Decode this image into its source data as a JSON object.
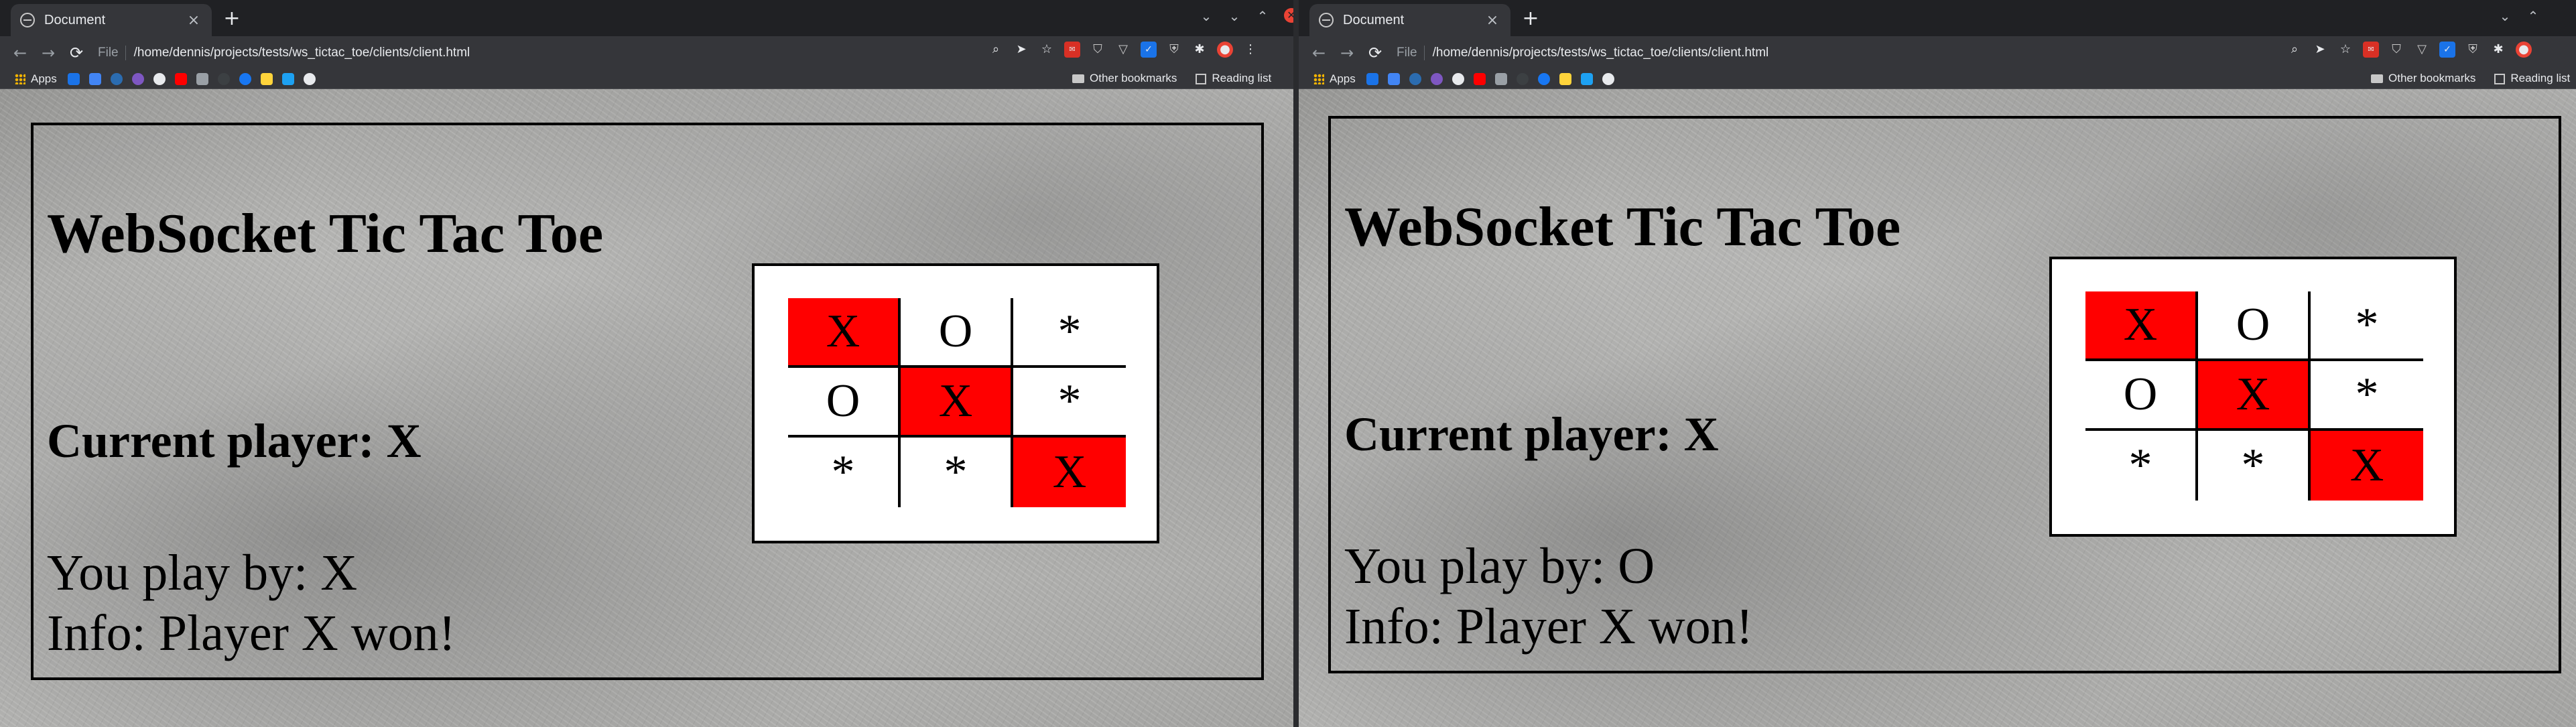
{
  "windows": [
    {
      "tab": {
        "title": "Document",
        "close": "×"
      },
      "new_tab": "+",
      "address": {
        "scheme": "File",
        "path": "/home/dennis/projects/tests/ws_tictac_toe/clients/client.html"
      },
      "bookmarks": {
        "apps": "Apps",
        "other": "Other bookmarks",
        "reading": "Reading list"
      },
      "page": {
        "heading": "WebSocket Tic Tac Toe",
        "current_player": "Current player: X",
        "you_play": "You play by: X",
        "info": "Info: Player X won!",
        "board": [
          "X",
          "O",
          "*",
          "O",
          "X",
          "*",
          "*",
          "*",
          "X"
        ],
        "winning_cells": [
          0,
          4,
          8
        ]
      }
    },
    {
      "tab": {
        "title": "Document",
        "close": "×"
      },
      "new_tab": "+",
      "address": {
        "scheme": "File",
        "path": "/home/dennis/projects/tests/ws_tictac_toe/clients/client.html"
      },
      "bookmarks": {
        "apps": "Apps",
        "other": "Other bookmarks",
        "reading": "Reading list"
      },
      "page": {
        "heading": "WebSocket Tic Tac Toe",
        "current_player": "Current player: X",
        "you_play": "You play by: O",
        "info": "Info: Player X won!",
        "board": [
          "X",
          "O",
          "*",
          "O",
          "X",
          "*",
          "*",
          "*",
          "X"
        ],
        "winning_cells": [
          0,
          4,
          8
        ]
      }
    }
  ],
  "colors": {
    "win_highlight": "#ff0000",
    "bookmark_extensions": "CBVI"
  }
}
